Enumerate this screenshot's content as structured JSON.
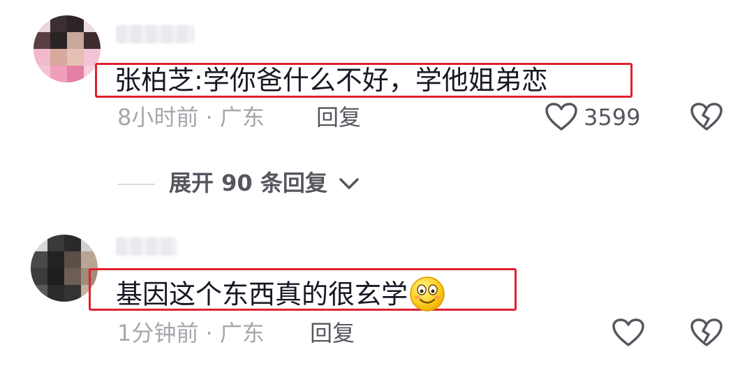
{
  "comments": [
    {
      "text": "张柏芝:学你爸什么不好，学他姐弟恋",
      "time": "8小时前",
      "location": "广东",
      "reply_label": "回复",
      "like_count": "3599"
    },
    {
      "text": "基因这个东西真的很玄学",
      "emoji": "smile-emoji",
      "time": "1分钟前",
      "location": "广东",
      "reply_label": "回复",
      "like_count": ""
    }
  ],
  "expand_replies": {
    "label": "展开 90 条回复"
  },
  "meta_separator": "·",
  "colors": {
    "highlight_box": "#e0202e",
    "text_primary": "#161823",
    "text_secondary": "#a6a6ad",
    "text_action": "#55565e"
  },
  "icons": [
    "heart-outline-icon",
    "broken-heart-icon",
    "chevron-down-icon"
  ]
}
